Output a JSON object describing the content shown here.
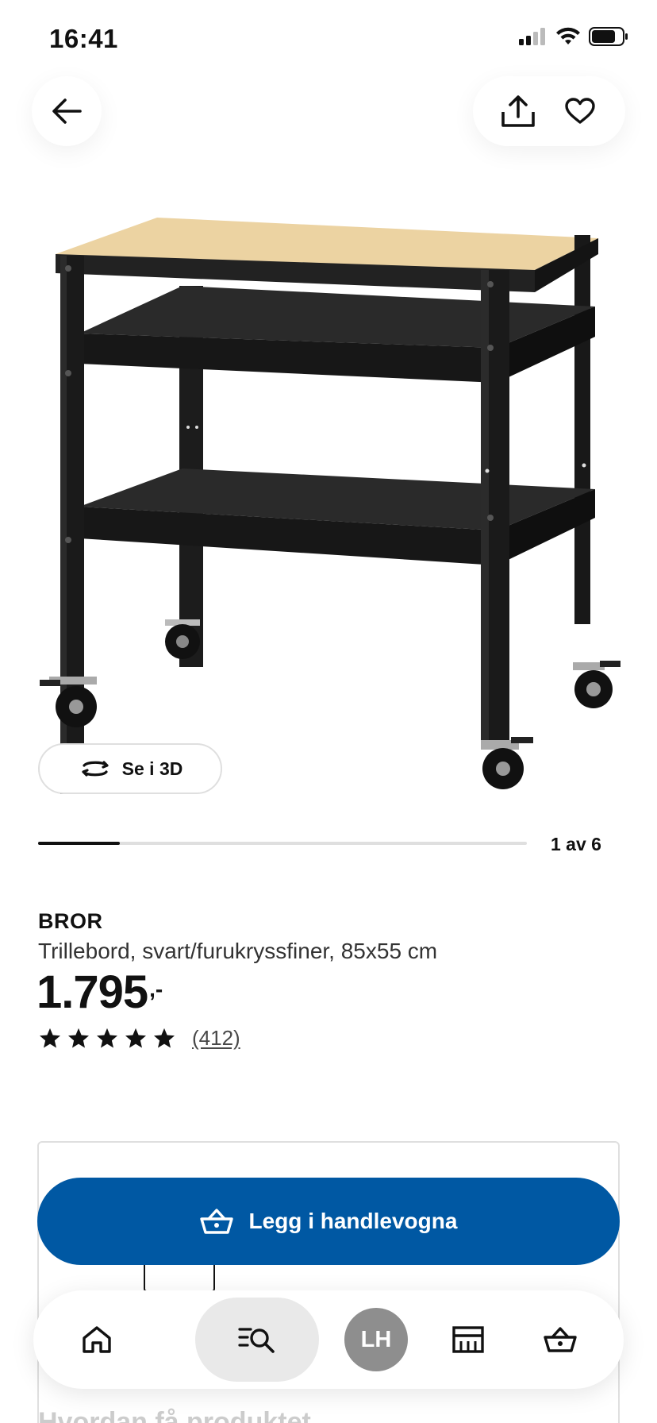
{
  "status_bar": {
    "time": "16:41"
  },
  "header": {
    "back_icon": "arrow-left-icon",
    "share_icon": "share-icon",
    "favorite_icon": "heart-icon"
  },
  "gallery": {
    "view_3d_label": "Se i 3D",
    "view_3d_icon": "rotate-3d-icon",
    "counter": "1 av 6",
    "current_image": 1,
    "total_images": 6
  },
  "product": {
    "name": "BROR",
    "description": "Trillebord, svart/furukryssfiner, 85x55 cm",
    "price": "1.795",
    "price_suffix": ",-",
    "rating_stars": 5,
    "review_count": "(412)"
  },
  "cart": {
    "add_to_cart_label": "Legg i handlevogna",
    "cart_icon": "basket-icon",
    "button_color": "#0058a3"
  },
  "below": {
    "section_title": "Hvordan få produktet"
  },
  "bottom_nav": {
    "items": [
      {
        "name": "home",
        "icon": "home-icon"
      },
      {
        "name": "search",
        "icon": "search-list-icon"
      },
      {
        "name": "profile",
        "label": "LH"
      },
      {
        "name": "stores",
        "icon": "store-icon"
      },
      {
        "name": "cart",
        "icon": "basket-icon"
      }
    ]
  }
}
